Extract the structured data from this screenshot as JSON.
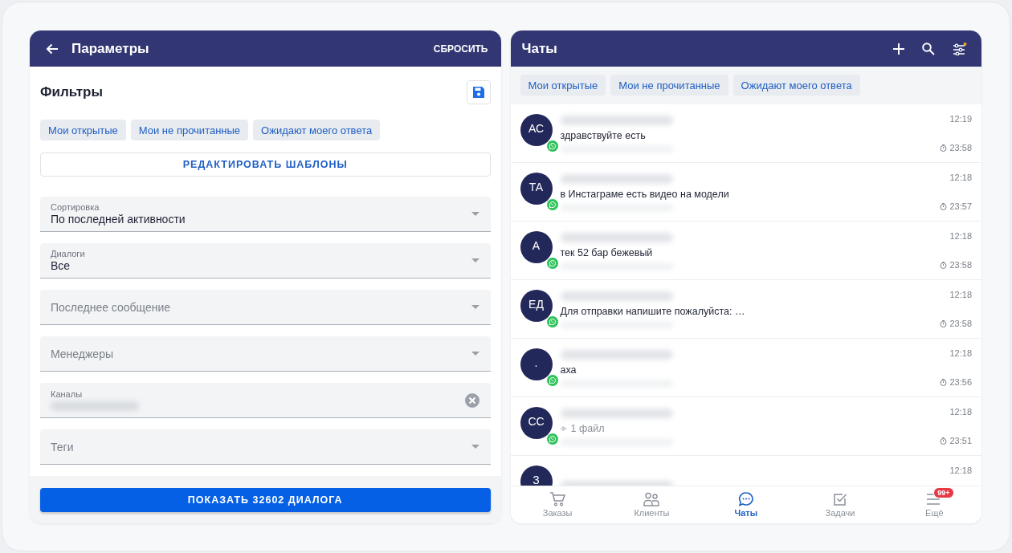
{
  "params": {
    "title": "Параметры",
    "reset": "СБРОСИТЬ",
    "section_title": "Фильтры",
    "chips": [
      "Мои открытые",
      "Мои не прочитанные",
      "Ожидают моего ответа"
    ],
    "edit_templates": "РЕДАКТИРОВАТЬ ШАБЛОНЫ",
    "fields": [
      {
        "kind": "select",
        "label": "Сортировка",
        "value": "По последней активности"
      },
      {
        "kind": "select",
        "label": "Диалоги",
        "value": "Все"
      },
      {
        "kind": "select",
        "placeholder": "Последнее сообщение"
      },
      {
        "kind": "select",
        "placeholder": "Менеджеры"
      },
      {
        "kind": "clearable",
        "label": "Каналы"
      },
      {
        "kind": "select",
        "placeholder": "Теги"
      }
    ],
    "show_button": "ПОКАЗАТЬ 32602 ДИАЛОГА"
  },
  "chats": {
    "title": "Чаты",
    "chips": [
      "Мои открытые",
      "Мои не прочитанные",
      "Ожидают моего ответа"
    ],
    "rows": [
      {
        "initials": "АС",
        "message": "здравствуйте есть",
        "time": "12:19",
        "wait": "23:58"
      },
      {
        "initials": "ТА",
        "message": "в Инстаграме есть видео на модели",
        "time": "12:18",
        "wait": "23:57"
      },
      {
        "initials": "А",
        "message": "тек 52 бар бежевый",
        "time": "12:18",
        "wait": "23:58"
      },
      {
        "initials": "ЕД",
        "message": "Для отправки напишите пожалуйста: …",
        "time": "12:18",
        "wait": "23:58"
      },
      {
        "initials": ".",
        "message": "аха",
        "time": "12:18",
        "wait": "23:56"
      },
      {
        "initials": "СС",
        "message": "1 файл",
        "attachment": true,
        "time": "12:18",
        "wait": "23:51"
      },
      {
        "initials": "З",
        "time": "12:18"
      }
    ],
    "nav": [
      {
        "kind": "cart",
        "label": "Заказы",
        "selected": false
      },
      {
        "kind": "clients",
        "label": "Клиенты",
        "selected": false
      },
      {
        "kind": "chat",
        "label": "Чаты",
        "selected": true
      },
      {
        "kind": "tasks",
        "label": "Задачи",
        "selected": false
      },
      {
        "kind": "more",
        "label": "Ещё",
        "selected": false,
        "badge": "99+"
      }
    ]
  }
}
